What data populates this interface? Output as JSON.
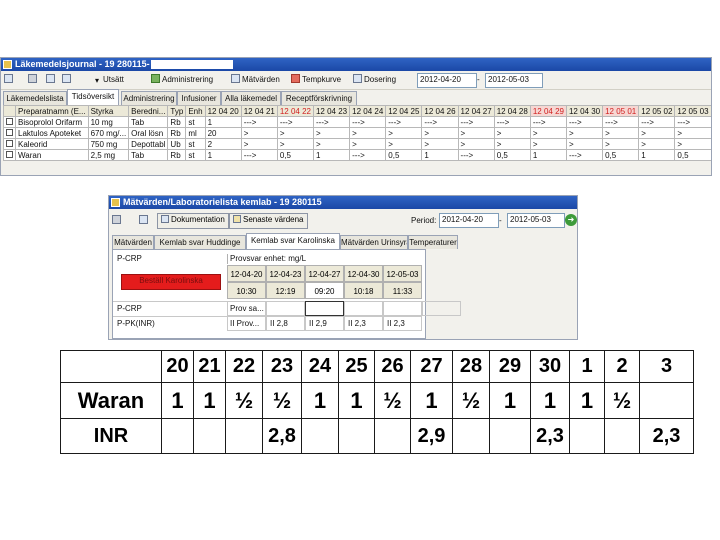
{
  "window1": {
    "title": "Läkemedelsjournal - 19 280115-",
    "toolbar": {
      "utsatt": "Utsätt",
      "administrering": "Administrering",
      "matvarden": "Mätvärden",
      "temperatur": "Tempkurve",
      "dosering": "Dosering",
      "date_from": "2012-04-20",
      "date_to": "2012-05-03"
    },
    "tabs": [
      "Läkemedelslista",
      "Tidsöversikt",
      "Administrering",
      "Infusioner",
      "Alla läkemedel",
      "Receptförskrivning"
    ],
    "active_tab": "Tidsöversikt",
    "columns": [
      "Preparatnamn (E...",
      "Styrka",
      "Beredni...",
      "Typ",
      "Enh",
      "12 04 20",
      "12 04 21",
      "12 04 22",
      "12 04 23",
      "12 04 24",
      "12 04 25",
      "12 04 26",
      "12 04 27",
      "12 04 28",
      "12 04 29",
      "12 04 30",
      "12 05 01",
      "12 05 02",
      "12 05 03"
    ],
    "rows": [
      [
        "Bisoprolol Orifarm",
        "10 mg",
        "Tab",
        "Rb",
        "st",
        "1",
        "--->",
        "--->",
        "--->",
        "--->",
        "--->",
        "--->",
        "--->",
        "--->",
        "--->",
        "--->",
        "--->",
        "--->",
        "--->"
      ],
      [
        "Laktulos Apoteket",
        "670 mg/...",
        "Oral lösn",
        "Rb",
        "ml",
        "20",
        ">",
        ">",
        ">",
        ">",
        ">",
        ">",
        ">",
        ">",
        ">",
        ">",
        ">",
        ">",
        ">"
      ],
      [
        "Kaleorid",
        "750 mg",
        "Depottabl",
        "Ub",
        "st",
        "2",
        ">",
        ">",
        ">",
        ">",
        ">",
        ">",
        ">",
        ">",
        ">",
        ">",
        ">",
        ">",
        ">"
      ],
      [
        "Waran",
        "2,5 mg",
        "Tab",
        "Rb",
        "st",
        "1",
        "--->",
        "0,5",
        "1",
        "--->",
        "0,5",
        "1",
        "--->",
        "0,5",
        "1",
        "--->",
        "0,5",
        "1",
        "0,5"
      ]
    ]
  },
  "window2": {
    "title": "Mätvärden/Laboratorielista kemlab - 19 280115",
    "toolbar": {
      "dokumentation": "Dokumentation",
      "senaste_varden": "Senaste värdena",
      "period_label": "Period:",
      "date_from": "2012-04-20",
      "date_to": "2012-05-03"
    },
    "tabs": [
      "Mätvärden",
      "Kemlab svar Huddinge",
      "Kemlab svar Karolinska",
      "Mätvärden Urinsyra",
      "Temperaturer"
    ],
    "active_tab": "Kemlab svar Karolinska",
    "analysis_name": "P-CRP",
    "provsvar_label": "Provsvar enhet: mg/L",
    "red_button": "Beställ Karolinska",
    "dates": [
      "12-04-20",
      "12-04-23",
      "12-04-27",
      "12-04-30",
      "12-05-03"
    ],
    "times": [
      "10:30",
      "12:19",
      "09:20",
      "10:18",
      "11:33"
    ],
    "rows": [
      {
        "name": "P-CRP",
        "unit": "Prov sa...",
        "values": [
          "",
          "",
          "",
          "",
          ""
        ]
      },
      {
        "name": "P-PK(INR)",
        "unit": "II Prov...",
        "values": [
          "II 2,8",
          "II 2,9",
          "II 2,3",
          "II 2,3"
        ]
      }
    ]
  },
  "summary": {
    "days": [
      "20",
      "21",
      "22",
      "23",
      "24",
      "25",
      "26",
      "27",
      "28",
      "29",
      "30",
      "1",
      "2",
      "3"
    ],
    "waran_label": "Waran",
    "waran": [
      "1",
      "1",
      "½",
      "½",
      "1",
      "1",
      "½",
      "1",
      "½",
      "1",
      "1",
      "1",
      "½",
      ""
    ],
    "inr_label": "INR",
    "inr": [
      "",
      "",
      "",
      "2,8",
      "",
      "",
      "",
      "2,9",
      "",
      "",
      "2,3",
      "",
      "",
      "2,3"
    ]
  },
  "colors": {
    "titlebar": "#1b48a6",
    "weekend_red": "#d11f1f",
    "order_button": "#e41c1c"
  }
}
